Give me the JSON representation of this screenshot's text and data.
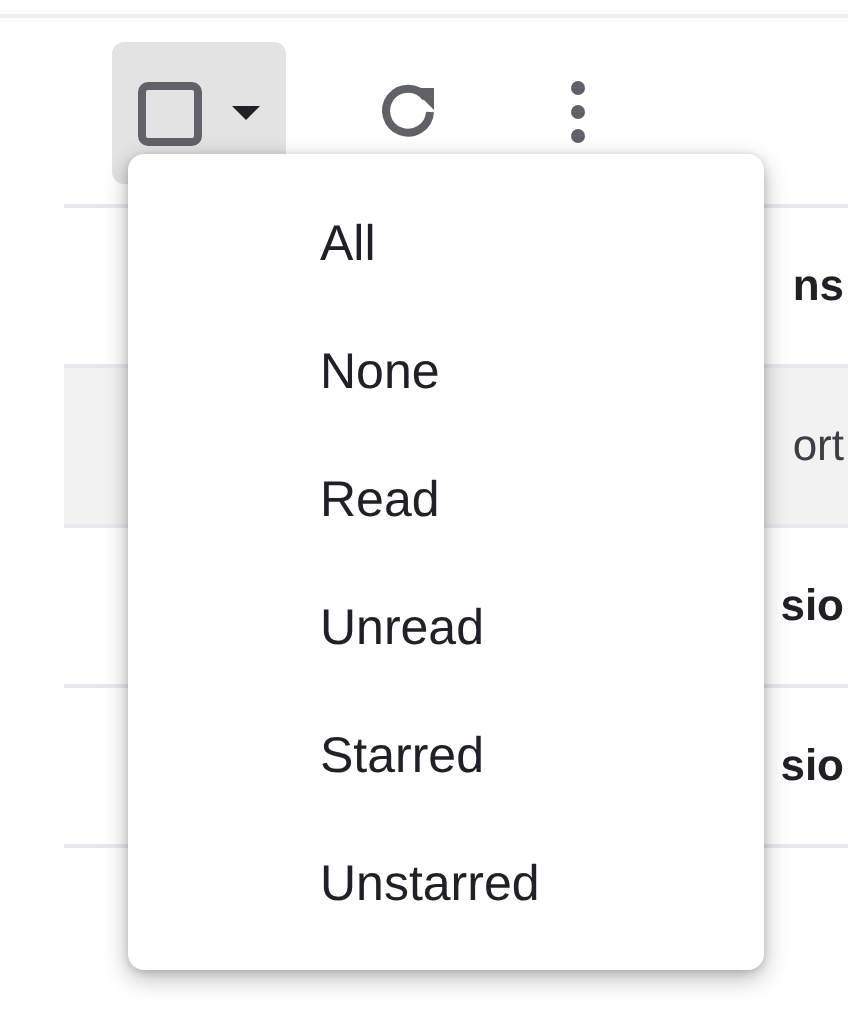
{
  "toolbar": {
    "select_checkbox": {
      "checked": false,
      "active": true
    }
  },
  "rows": [
    {
      "text": "ns",
      "bold": true,
      "highlighted": false
    },
    {
      "text": "ort",
      "bold": false,
      "highlighted": true
    },
    {
      "text": "sio",
      "bold": true,
      "highlighted": false
    },
    {
      "text": "sio",
      "bold": true,
      "highlighted": false
    },
    {
      "highlighted": false
    }
  ],
  "menu": {
    "items": [
      "All",
      "None",
      "Read",
      "Unread",
      "Starred",
      "Unstarred"
    ]
  }
}
